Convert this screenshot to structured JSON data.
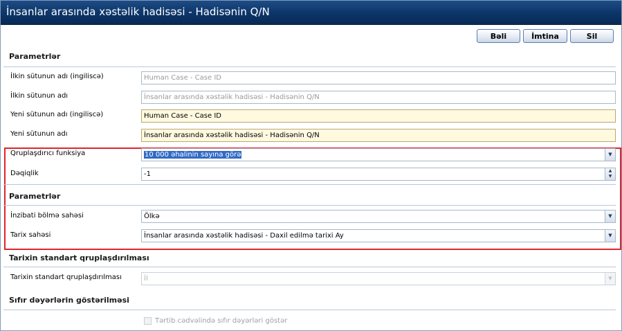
{
  "window": {
    "title": "İnsanlar arasında xəstəlik hadisəsi - Hadisənin Q/N"
  },
  "toolbar": {
    "ok_label": "Bəli",
    "cancel_label": "İmtina",
    "delete_label": "Sil"
  },
  "sections": {
    "parameters_1": "Parametrlər",
    "parameters_2": "Parametrlər",
    "date_grouping": "Tarixin standart qruplaşdırılması",
    "zero_values": "Sıfır dəyərlərin göstərilməsi"
  },
  "fields": {
    "orig_name_en": {
      "label": "İlkin sütunun adı (ingiliscə)",
      "value": "Human Case - Case ID"
    },
    "orig_name": {
      "label": "İlkin sütunun adı",
      "value": "İnsanlar arasında xəstəlik hadisəsi - Hadisənin Q/N"
    },
    "new_name_en": {
      "label": "Yeni sütunun adı (ingiliscə)",
      "value": "Human Case - Case ID"
    },
    "new_name": {
      "label": "Yeni sütunun adı",
      "value": "İnsanlar arasında xəstəlik hadisəsi - Hadisənin Q/N"
    },
    "grouping_function": {
      "label": "Qruplaşdırıcı funksiya",
      "value": "10 000 əhalinin sayına görə"
    },
    "precision": {
      "label": "Dəqiqlik",
      "value": "-1"
    },
    "admin_unit_field": {
      "label": "İnzibati bölmə sahəsi",
      "value": "Ölkə"
    },
    "date_field": {
      "label": "Tarix sahəsi",
      "value": "İnsanlar arasında xəstəlik hadisəsi - Daxil edilmə tarixi Ay"
    },
    "date_grouping": {
      "label": "Tarixin standart qruplaşdırılması",
      "value": "İl"
    }
  },
  "checkbox": {
    "show_zero_label": "Tərtib cədvəlində sıfır dəyərləri göstər",
    "checked": false
  },
  "colors": {
    "titlebar": "#0c3568",
    "highlight_border": "#e0242b",
    "editable_bg": "#fff9e0",
    "selection": "#316ac5"
  },
  "icons": {
    "dropdown": "chevron-down-icon",
    "spinner": "spinner-arrows-icon"
  }
}
